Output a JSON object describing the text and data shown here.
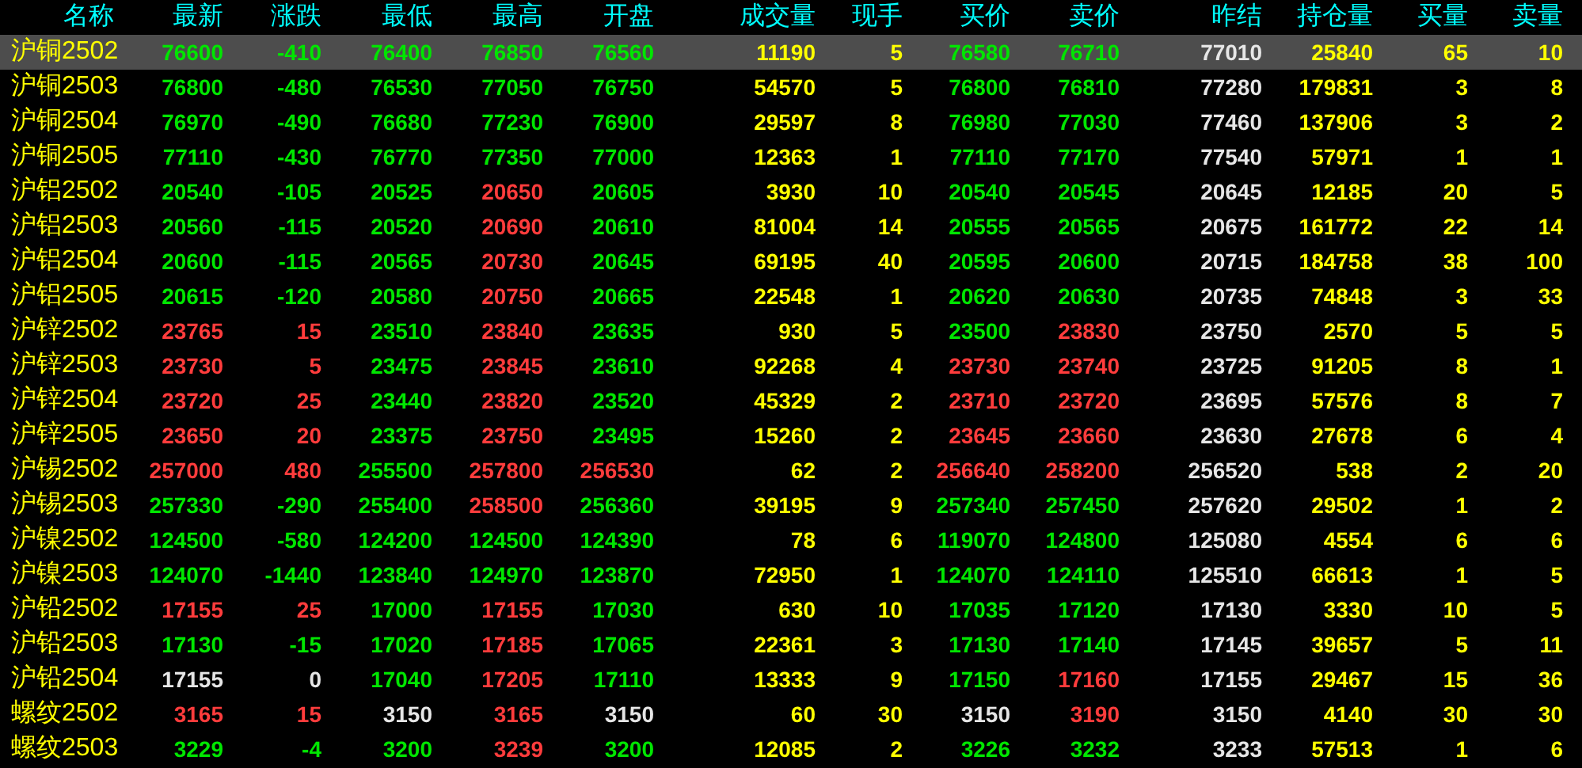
{
  "table": {
    "columns": [
      {
        "label": "名称",
        "kind": "name"
      },
      {
        "label": "最新",
        "kind": "price"
      },
      {
        "label": "涨跌",
        "kind": "change"
      },
      {
        "label": "最低",
        "kind": "price"
      },
      {
        "label": "最高",
        "kind": "price"
      },
      {
        "label": "开盘",
        "kind": "price"
      },
      {
        "label": "成交量",
        "kind": "volume"
      },
      {
        "label": "现手",
        "kind": "volume"
      },
      {
        "label": "买价",
        "kind": "price"
      },
      {
        "label": "卖价",
        "kind": "price"
      },
      {
        "label": "昨结",
        "kind": "prev_close"
      },
      {
        "label": "持仓量",
        "kind": "volume"
      },
      {
        "label": "买量",
        "kind": "volume"
      },
      {
        "label": "卖量",
        "kind": "volume"
      }
    ],
    "rows": [
      {
        "selected": true,
        "cells": [
          "沪铜2502",
          "76600",
          "-410",
          "76400",
          "76850",
          "76560",
          "11190",
          "5",
          "76580",
          "76710",
          "77010",
          "25840",
          "65",
          "10"
        ]
      },
      {
        "selected": false,
        "cells": [
          "沪铜2503",
          "76800",
          "-480",
          "76530",
          "77050",
          "76750",
          "54570",
          "5",
          "76800",
          "76810",
          "77280",
          "179831",
          "3",
          "8"
        ]
      },
      {
        "selected": false,
        "cells": [
          "沪铜2504",
          "76970",
          "-490",
          "76680",
          "77230",
          "76900",
          "29597",
          "8",
          "76980",
          "77030",
          "77460",
          "137906",
          "3",
          "2"
        ]
      },
      {
        "selected": false,
        "cells": [
          "沪铜2505",
          "77110",
          "-430",
          "76770",
          "77350",
          "77000",
          "12363",
          "1",
          "77110",
          "77170",
          "77540",
          "57971",
          "1",
          "1"
        ]
      },
      {
        "selected": false,
        "cells": [
          "沪铝2502",
          "20540",
          "-105",
          "20525",
          "20650",
          "20605",
          "3930",
          "10",
          "20540",
          "20545",
          "20645",
          "12185",
          "20",
          "5"
        ]
      },
      {
        "selected": false,
        "cells": [
          "沪铝2503",
          "20560",
          "-115",
          "20520",
          "20690",
          "20610",
          "81004",
          "14",
          "20555",
          "20565",
          "20675",
          "161772",
          "22",
          "14"
        ]
      },
      {
        "selected": false,
        "cells": [
          "沪铝2504",
          "20600",
          "-115",
          "20565",
          "20730",
          "20645",
          "69195",
          "40",
          "20595",
          "20600",
          "20715",
          "184758",
          "38",
          "100"
        ]
      },
      {
        "selected": false,
        "cells": [
          "沪铝2505",
          "20615",
          "-120",
          "20580",
          "20750",
          "20665",
          "22548",
          "1",
          "20620",
          "20630",
          "20735",
          "74848",
          "3",
          "33"
        ]
      },
      {
        "selected": false,
        "cells": [
          "沪锌2502",
          "23765",
          "15",
          "23510",
          "23840",
          "23635",
          "930",
          "5",
          "23500",
          "23830",
          "23750",
          "2570",
          "5",
          "5"
        ]
      },
      {
        "selected": false,
        "cells": [
          "沪锌2503",
          "23730",
          "5",
          "23475",
          "23845",
          "23610",
          "92268",
          "4",
          "23730",
          "23740",
          "23725",
          "91205",
          "8",
          "1"
        ]
      },
      {
        "selected": false,
        "cells": [
          "沪锌2504",
          "23720",
          "25",
          "23440",
          "23820",
          "23520",
          "45329",
          "2",
          "23710",
          "23720",
          "23695",
          "57576",
          "8",
          "7"
        ]
      },
      {
        "selected": false,
        "cells": [
          "沪锌2505",
          "23650",
          "20",
          "23375",
          "23750",
          "23495",
          "15260",
          "2",
          "23645",
          "23660",
          "23630",
          "27678",
          "6",
          "4"
        ]
      },
      {
        "selected": false,
        "cells": [
          "沪锡2502",
          "257000",
          "480",
          "255500",
          "257800",
          "256530",
          "62",
          "2",
          "256640",
          "258200",
          "256520",
          "538",
          "2",
          "20"
        ]
      },
      {
        "selected": false,
        "cells": [
          "沪锡2503",
          "257330",
          "-290",
          "255400",
          "258500",
          "256360",
          "39195",
          "9",
          "257340",
          "257450",
          "257620",
          "29502",
          "1",
          "2"
        ]
      },
      {
        "selected": false,
        "cells": [
          "沪镍2502",
          "124500",
          "-580",
          "124200",
          "124500",
          "124390",
          "78",
          "6",
          "119070",
          "124800",
          "125080",
          "4554",
          "6",
          "6"
        ]
      },
      {
        "selected": false,
        "cells": [
          "沪镍2503",
          "124070",
          "-1440",
          "123840",
          "124970",
          "123870",
          "72950",
          "1",
          "124070",
          "124110",
          "125510",
          "66613",
          "1",
          "5"
        ]
      },
      {
        "selected": false,
        "cells": [
          "沪铅2502",
          "17155",
          "25",
          "17000",
          "17155",
          "17030",
          "630",
          "10",
          "17035",
          "17120",
          "17130",
          "3330",
          "10",
          "5"
        ]
      },
      {
        "selected": false,
        "cells": [
          "沪铅2503",
          "17130",
          "-15",
          "17020",
          "17185",
          "17065",
          "22361",
          "3",
          "17130",
          "17140",
          "17145",
          "39657",
          "5",
          "11"
        ]
      },
      {
        "selected": false,
        "cells": [
          "沪铅2504",
          "17155",
          "0",
          "17040",
          "17205",
          "17110",
          "13333",
          "9",
          "17150",
          "17160",
          "17155",
          "29467",
          "15",
          "36"
        ]
      },
      {
        "selected": false,
        "cells": [
          "螺纹2502",
          "3165",
          "15",
          "3150",
          "3165",
          "3150",
          "60",
          "30",
          "3150",
          "3190",
          "3150",
          "4140",
          "30",
          "30"
        ]
      },
      {
        "selected": false,
        "cells": [
          "螺纹2503",
          "3229",
          "-4",
          "3200",
          "3239",
          "3200",
          "12085",
          "2",
          "3226",
          "3232",
          "3233",
          "57513",
          "1",
          "6"
        ]
      }
    ]
  }
}
